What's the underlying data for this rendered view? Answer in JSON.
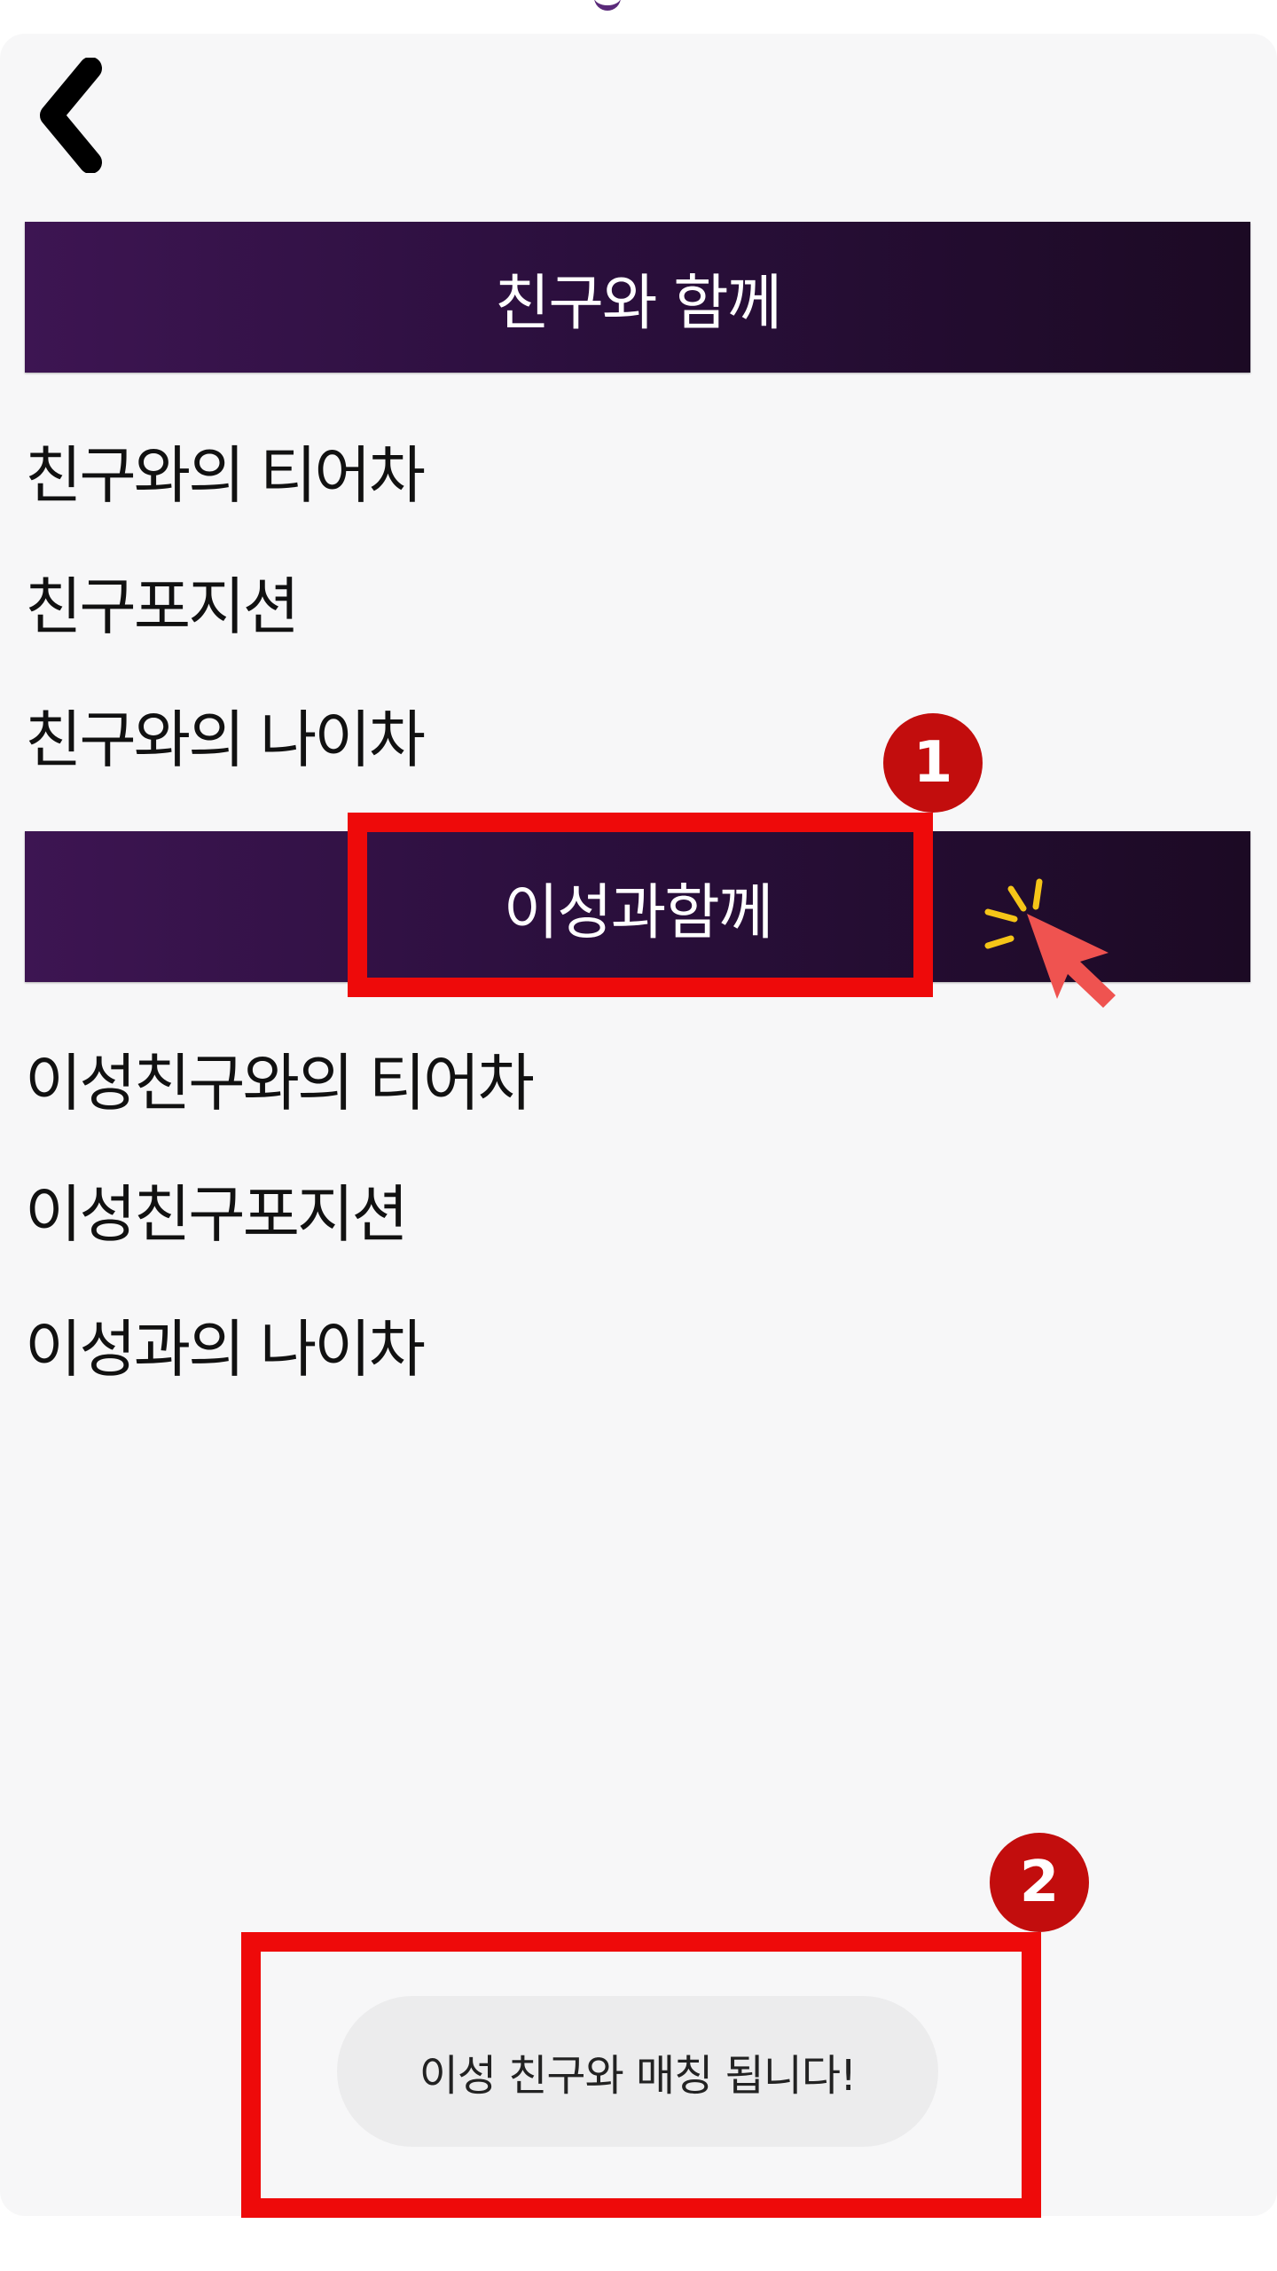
{
  "header": {
    "back_icon": "chevron-left-icon"
  },
  "sections": [
    {
      "title": "친구와 함께",
      "items": [
        {
          "label": "친구와의 티어차"
        },
        {
          "label": "친구포지션"
        },
        {
          "label": "친구와의 나이차"
        }
      ]
    },
    {
      "title": "이성과함께",
      "items": [
        {
          "label": "이성친구와의 티어차"
        },
        {
          "label": "이성친구포지션"
        },
        {
          "label": "이성과의 나이차"
        }
      ]
    }
  ],
  "annotations": {
    "step1_label": "1",
    "step2_label": "2",
    "highlight_color": "#ee0a0a",
    "badge_color": "#c20d0d"
  },
  "toast": {
    "message": "이성 친구와 매칭 됩니다!"
  },
  "colors": {
    "header_gradient_start": "#3d1552",
    "header_gradient_end": "#1c0a24",
    "background": "#f7f7f8"
  }
}
